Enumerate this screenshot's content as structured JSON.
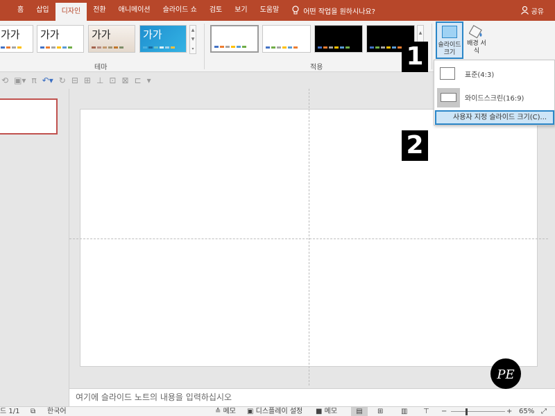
{
  "menubar": {
    "tabs": [
      "홈",
      "삽입",
      "디자인",
      "전환",
      "애니메이션",
      "슬라이드 쇼",
      "검토",
      "보기",
      "도움말"
    ],
    "active_tab": "디자인",
    "tell_me": "어떤 작업을 원하시나요?",
    "share": "공유"
  },
  "ribbon": {
    "themes_group": "테마",
    "variants_group": "적용",
    "theme_thumb_text": "가가",
    "slide_size_label": "슬라이드 크기",
    "format_background_label": "배경 서식"
  },
  "dropdown": {
    "standard": "표준(4:3)",
    "widescreen": "와이드스크린(16:9)",
    "custom": "사용자 지정 슬라이드 크기(C)..."
  },
  "callouts": [
    "1",
    "2"
  ],
  "notes_placeholder": "여기에 슬라이드 노트의 내용을 입력하십시오",
  "status": {
    "slide_count": "드 1/1",
    "language": "한국어",
    "notes": "메모",
    "display_settings": "디스플레이 설정",
    "comments": "메모",
    "zoom": "65%"
  },
  "logo_text": "PE",
  "colors": {
    "accent": "#b7472a",
    "highlight": "#2a86c8",
    "selection_border": "#c0504d"
  }
}
